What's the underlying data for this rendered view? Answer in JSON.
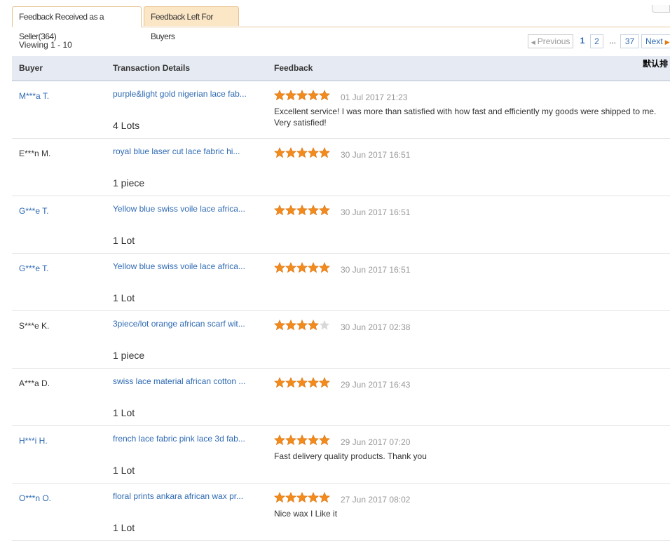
{
  "tabs": [
    {
      "label": "Feedback Received as a Seller(364)",
      "active": true
    },
    {
      "label": "Feedback Left For Buyers",
      "active": false
    }
  ],
  "viewing": "Viewing 1 - 10",
  "pager": {
    "prev": "Previous",
    "current": "1",
    "page2": "2",
    "ellipsis": "...",
    "last": "37",
    "next": "Next"
  },
  "header": {
    "buyer": "Buyer",
    "transaction": "Transaction Details",
    "feedback": "Feedback",
    "sort_label": "默认排"
  },
  "colors": {
    "link": "#2f6ab3",
    "star": "#f28a1c",
    "star_empty": "#d9d9d9",
    "tab_active_border": "#e5c28f",
    "tab_inactive_bg": "#fbe6c6",
    "header_bg": "#e6eaf2"
  },
  "rows": [
    {
      "buyer": "M***a T.",
      "buyer_link": true,
      "product": "purple&light gold nigerian lace fab...",
      "quantity": "4 Lots",
      "rating": 5,
      "date": "01 Jul 2017 21:23",
      "comment": "Excellent service! I was more than satisfied with how fast and efficiently my goods were shipped to me. Very satisfied!"
    },
    {
      "buyer": "E***n M.",
      "buyer_link": false,
      "product": "royal blue laser cut lace fabric hi...",
      "quantity": "1 piece",
      "rating": 5,
      "date": "30 Jun 2017 16:51",
      "comment": ""
    },
    {
      "buyer": "G***e T.",
      "buyer_link": true,
      "product": "Yellow blue swiss voile lace africa...",
      "quantity": "1 Lot",
      "rating": 5,
      "date": "30 Jun 2017 16:51",
      "comment": ""
    },
    {
      "buyer": "G***e T.",
      "buyer_link": true,
      "product": "Yellow blue swiss voile lace africa...",
      "quantity": "1 Lot",
      "rating": 5,
      "date": "30 Jun 2017 16:51",
      "comment": ""
    },
    {
      "buyer": "S***e K.",
      "buyer_link": false,
      "product": "3piece/lot orange african scarf wit...",
      "quantity": "1 piece",
      "rating": 4,
      "date": "30 Jun 2017 02:38",
      "comment": ""
    },
    {
      "buyer": "A***a D.",
      "buyer_link": false,
      "product": "swiss lace material african cotton ...",
      "quantity": "1 Lot",
      "rating": 5,
      "date": "29 Jun 2017 16:43",
      "comment": ""
    },
    {
      "buyer": "H***i H.",
      "buyer_link": true,
      "product": "french lace fabric pink lace 3d fab...",
      "quantity": "1 Lot",
      "rating": 5,
      "date": "29 Jun 2017 07:20",
      "comment": "Fast delivery quality products. Thank you"
    },
    {
      "buyer": "O***n O.",
      "buyer_link": true,
      "product": "floral prints ankara african wax pr...",
      "quantity": "1 Lot",
      "rating": 5,
      "date": "27 Jun 2017 08:02",
      "comment": "Nice wax I Like it"
    }
  ]
}
